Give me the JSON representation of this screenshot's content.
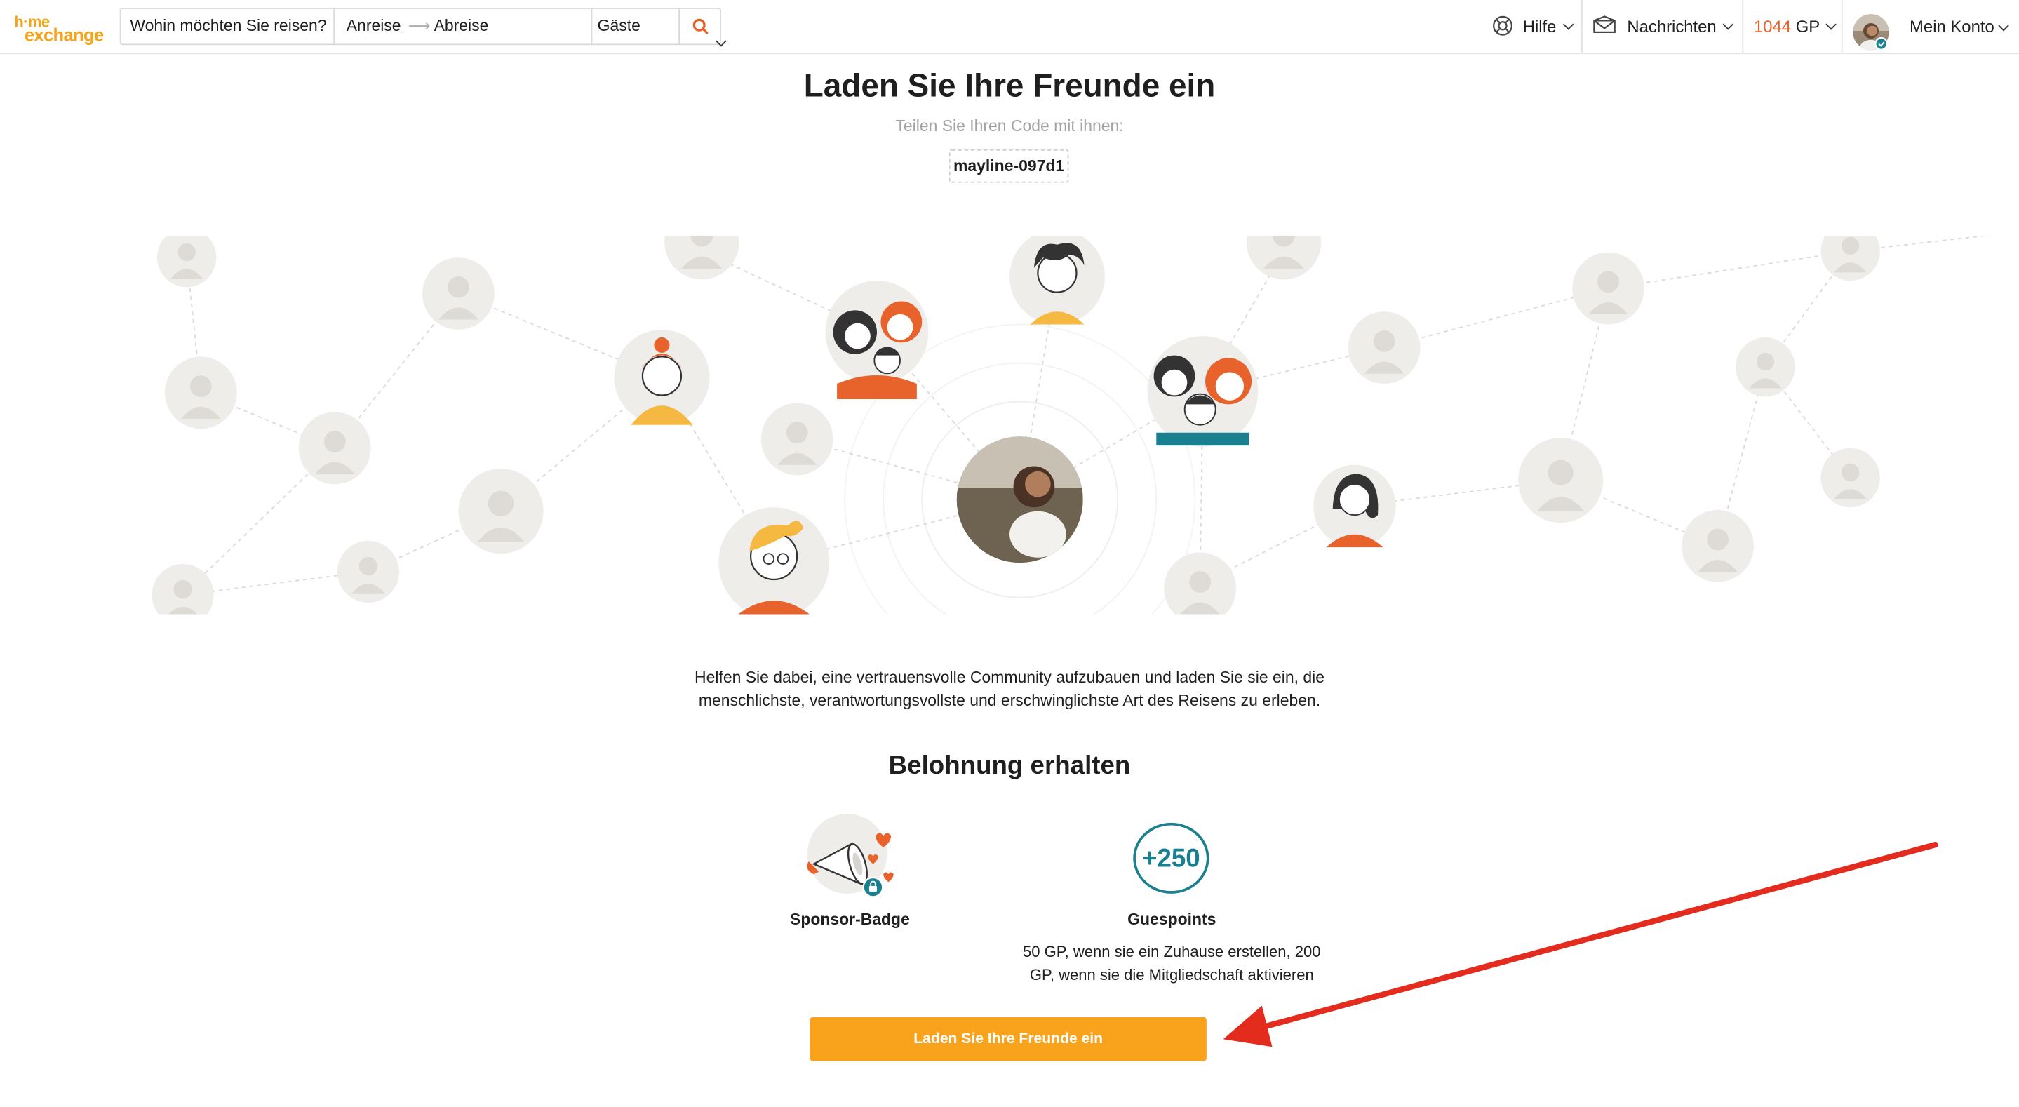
{
  "header": {
    "logo_line1": "h·me",
    "logo_line2": "exchange",
    "search_placeholder": "Wohin möchten Sie reisen?",
    "checkin": "Anreise",
    "checkout": "Abreise",
    "guests": "Gäste",
    "help": "Hilfe",
    "messages": "Nachrichten",
    "points_value": "1044",
    "points_unit": "GP",
    "account": "Mein Konto"
  },
  "main": {
    "title": "Laden Sie Ihre Freunde ein",
    "subtitle": "Teilen Sie Ihren Code mit ihnen:",
    "code": "mayline-097d1",
    "paragraph_line1": "Helfen Sie dabei, eine vertrauensvolle Community aufzubauen und laden Sie sie ein, die",
    "paragraph_line2": "menschlichste, verantwortungsvollste und erschwinglichste Art des Reisens zu erleben.",
    "reward_title": "Belohnung erhalten",
    "badge_label": "Sponsor-Badge",
    "gp_value": "+250",
    "gp_label": "Guespoints",
    "gp_desc_line1": "50 GP, wenn sie ein Zuhause erstellen, 200",
    "gp_desc_line2": "GP, wenn sie die Mitgliedschaft aktivieren",
    "cta_label": "Laden Sie Ihre Freunde ein"
  },
  "colors": {
    "brand": "#f5a31a",
    "cta": "#f9a21b",
    "teal": "#1a7f8e",
    "points": "#e8622c",
    "arrow": "#e32b1e"
  },
  "icons": [
    "search-icon",
    "help-lifebuoy-icon",
    "envelope-icon",
    "avatar",
    "megaphone-icon",
    "lock-icon",
    "arrow-annotation"
  ]
}
